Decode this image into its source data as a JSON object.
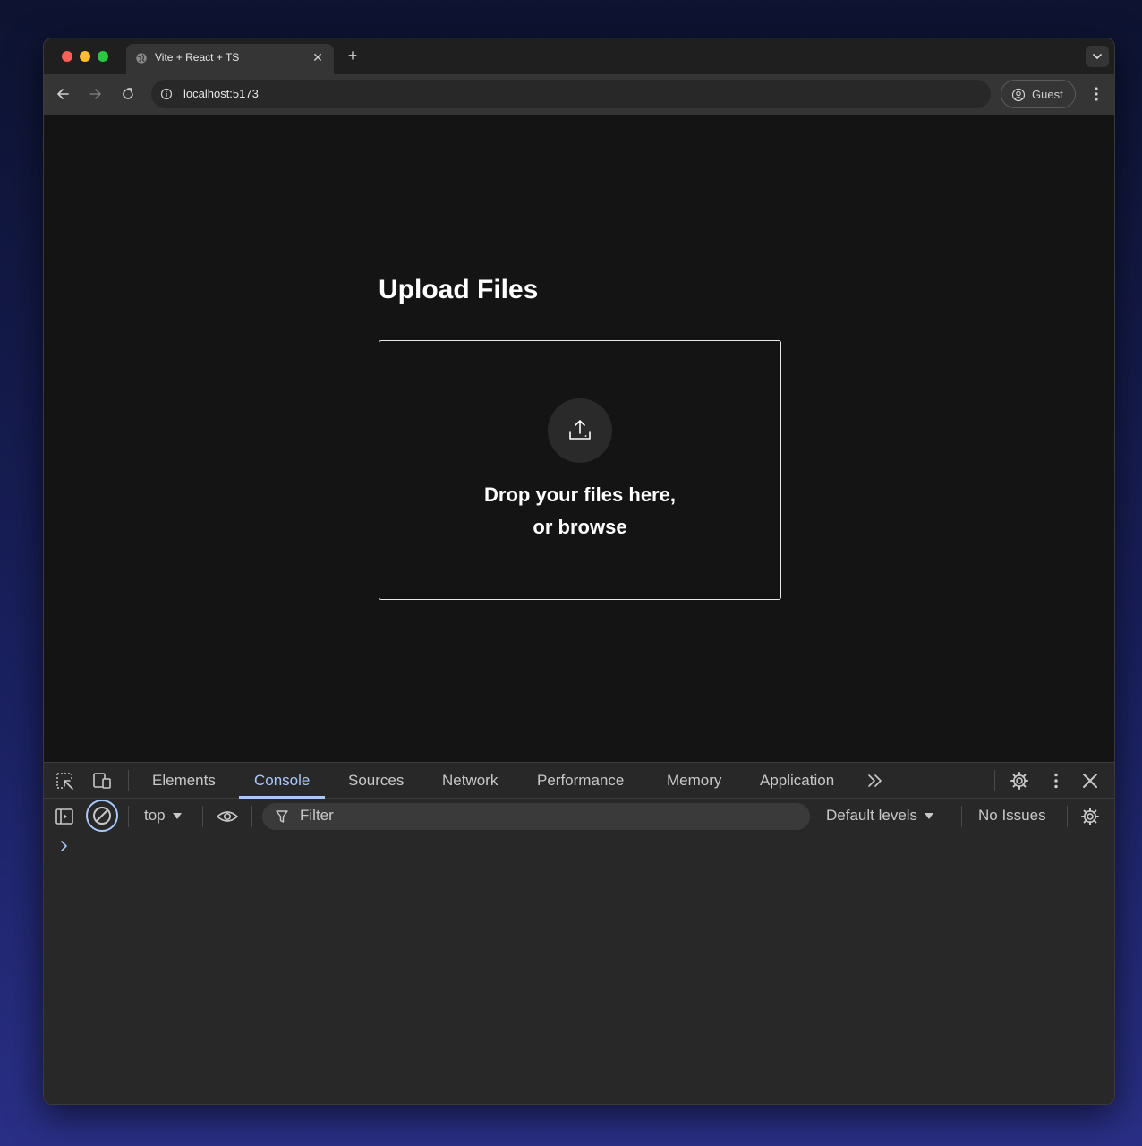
{
  "browser": {
    "tab_title": "Vite + React + TS",
    "tab_close": "✕",
    "new_tab": "+",
    "url": "localhost:5173",
    "profile_label": "Guest"
  },
  "page": {
    "title": "Upload Files",
    "drop_line1": "Drop your files here,",
    "drop_line2": "or browse"
  },
  "devtools": {
    "tabs": [
      "Elements",
      "Console",
      "Sources",
      "Network",
      "Performance",
      "Memory",
      "Application"
    ],
    "active_tab": "Console",
    "more_tabs": "»",
    "context": "top",
    "filter_placeholder": "Filter",
    "levels": "Default levels",
    "issues": "No Issues"
  },
  "colors": {
    "accent": "#a8c7fa",
    "page_bg": "#141414",
    "devtools_bg": "#282828"
  }
}
